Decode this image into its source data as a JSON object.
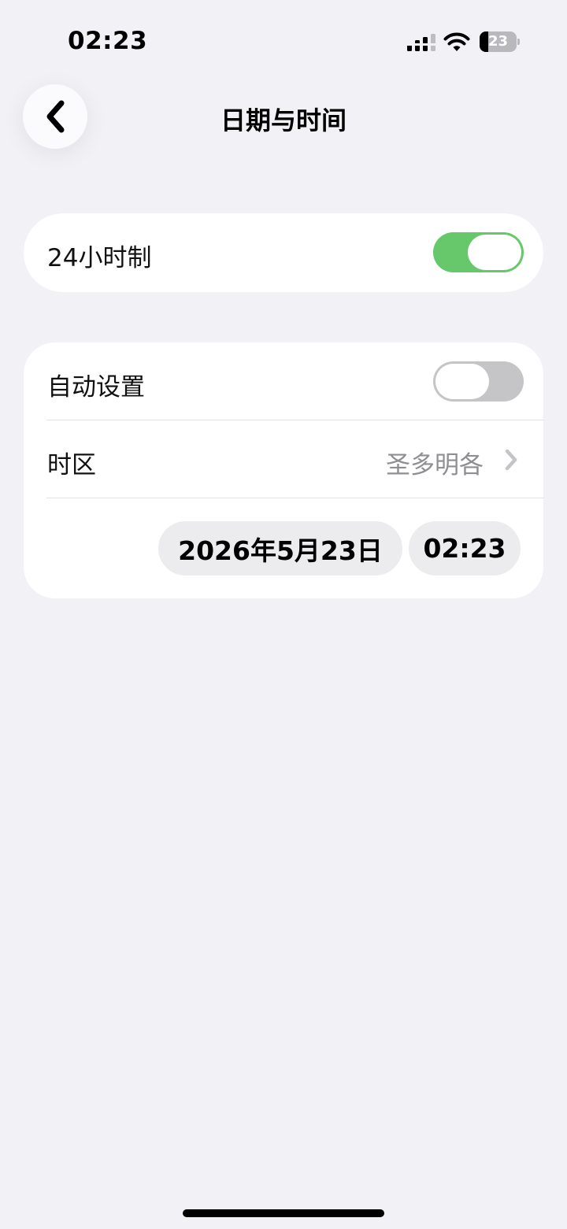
{
  "status_bar": {
    "time": "02:23",
    "battery_level": "23",
    "battery_fraction": 0.23,
    "signal_icon": "cellular-signal-icon",
    "wifi_icon": "wifi-icon"
  },
  "nav": {
    "title": "日期与时间",
    "back_icon": "chevron-left-icon"
  },
  "settings": {
    "hour24": {
      "label": "24小时制",
      "enabled": true
    },
    "auto_set": {
      "label": "自动设置",
      "enabled": false
    },
    "timezone": {
      "label": "时区",
      "value": "圣多明各"
    },
    "date": "2026年5月23日",
    "time": "02:23"
  },
  "colors": {
    "background": "#f2f1f6",
    "toggle_on": "#66c86a",
    "toggle_off": "#c5c5c7",
    "secondary_text": "#8e8e93"
  }
}
